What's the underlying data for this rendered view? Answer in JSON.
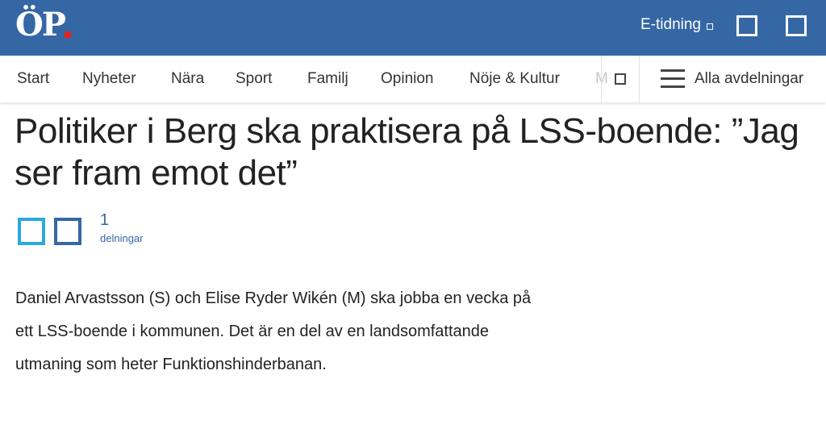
{
  "header": {
    "logo_text": "ÖP",
    "etidning_label": "E-tidning",
    "brand_color": "#3567a5",
    "accent_color": "#e2231a",
    "icons": [
      "external-link-icon",
      "user-icon",
      "search-icon"
    ]
  },
  "nav": {
    "items": [
      "Start",
      "Nyheter",
      "Nära",
      "Sport",
      "Familj",
      "Opinion",
      "Nöje & Kultur"
    ],
    "overflow_fragment": "M",
    "all_sections_label": "Alla avdelningar"
  },
  "article": {
    "headline": "Politiker i Berg ska praktisera på LSS-boende: ”Jag ser fram emot det”",
    "share_count": "1",
    "share_label": "delningar",
    "ingress": "Daniel Arvastsson (S) och Elise Ryder Wikén (M) ska jobba en vecka på ett LSS-boende i kommunen. Det är en del av en landsomfattande utmaning som heter Funktionshinderbanan."
  }
}
